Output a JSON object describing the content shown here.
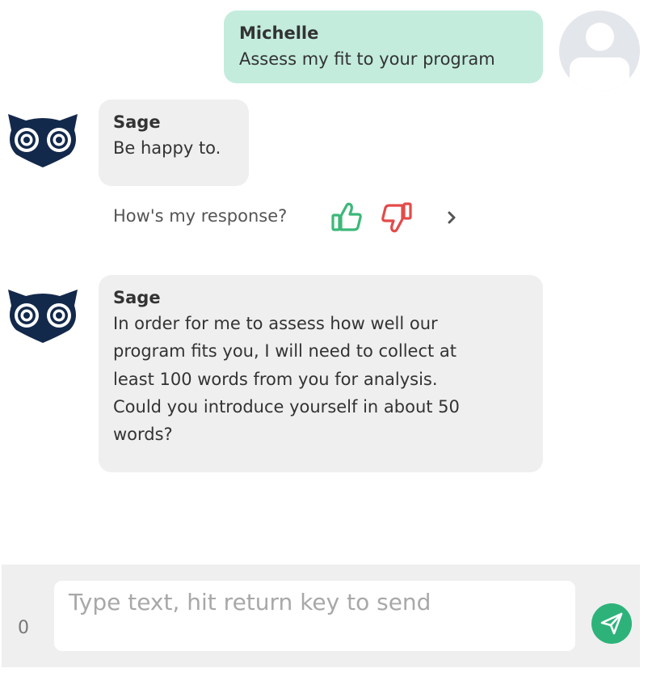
{
  "messages": {
    "user": {
      "sender": "Michelle",
      "text": "Assess my fit to your program"
    },
    "bot_1": {
      "sender": "Sage",
      "text": "Be happy to."
    },
    "bot_2": {
      "sender": "Sage",
      "text": "In order for me to assess how well our\nprogram fits you, I will need to collect at\nleast 100 words from you for analysis.\nCould you introduce yourself in about 50\nwords?"
    }
  },
  "feedback": {
    "prompt": "How's my response?",
    "icons": [
      "thumbs-up-icon",
      "thumbs-down-icon",
      "chevron-right-icon"
    ]
  },
  "composer": {
    "counter": "0",
    "placeholder": "Type text, hit return key to send",
    "value": "",
    "send_icon": "paper-plane-icon"
  },
  "colors": {
    "user_bubble": "#c3ecdd",
    "bot_bubble": "#efefef",
    "owl_navy": "#13294b",
    "thumb_up": "#3cb878",
    "thumb_down": "#e34a4a",
    "send_button": "#2db37a"
  }
}
